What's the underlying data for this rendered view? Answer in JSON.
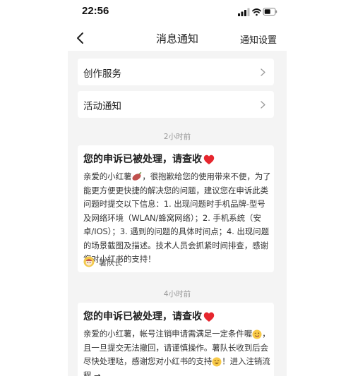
{
  "status_bar": {
    "time": "22:56"
  },
  "nav": {
    "title": "消息通知",
    "right_action": "通知设置"
  },
  "menu": [
    {
      "label": "创作服务"
    },
    {
      "label": "活动通知"
    }
  ],
  "messages": [
    {
      "time": "2小时前",
      "title": "您的申诉已被处理，请查收",
      "body_before": "亲爱的小红薯",
      "body_after": "，很抱歉给您的使用带来不便，为了能更方便更快捷的解决您的问题，建议您在申诉此类问题时提交以下信息：1. 出现问题时手机品牌-型号及网络环境（WLAN/蜂窝网络）；2. 手机系统（安卓/IOS）；3. 遇到的问题的具体时间点；4. 出现问题的场景截图及描述。技术人员会抓紧时间排查，感谢您对小红书的支持！",
      "sender": "薯队长"
    },
    {
      "time": "4小时前",
      "title": "您的申诉已被处理，请查收",
      "body_part1": "亲爱的小红薯，帐号注销申请需满足一定条件喔",
      "body_part2": "，且一旦提交无法撤回，请谨慎操作。薯队长收到后会尽快处理哒，感谢您对小红书的支持",
      "body_part3": "！进入注销流程",
      "link_arrow": "→"
    }
  ],
  "colors": {
    "page_bg": "#f4f4f4",
    "card_bg": "#ffffff",
    "heart": "#e6262e",
    "muted": "#9a9a9a"
  },
  "icons": [
    "signal-icon",
    "wifi-icon",
    "battery-icon",
    "back-chevron-icon",
    "chevron-right-icon",
    "heart-icon",
    "sweet-potato-icon",
    "avatar-icon",
    "wink-emoji-icon",
    "smile-emoji-icon"
  ]
}
